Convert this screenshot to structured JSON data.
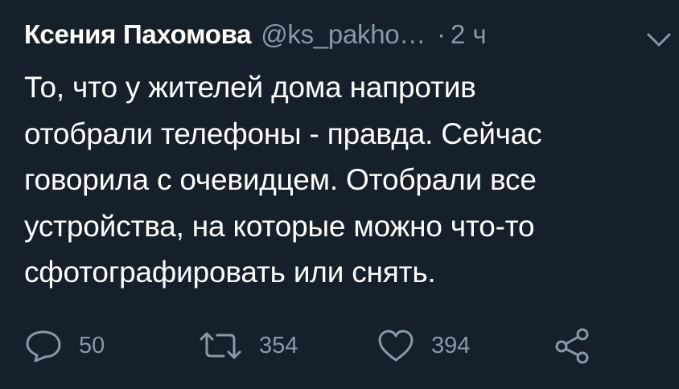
{
  "tweet": {
    "author_name": "Ксения Пахомова",
    "author_handle": "@ks_pakho…",
    "separator": "·",
    "time": "2 ч",
    "text_lines": [
      "То, что у жителей дома напротив",
      "отобрали телефоны - правда. Сейчас",
      "говорила с очевидцем. Отобрали все",
      "устройства, на которые можно что-то",
      "сфотографировать или снять."
    ],
    "actions": {
      "reply_count": "50",
      "retweet_count": "354",
      "like_count": "394"
    }
  },
  "icons": {
    "menu": "chevron-down-icon",
    "reply": "reply-icon",
    "retweet": "retweet-icon",
    "like": "heart-icon",
    "share": "share-icon"
  },
  "colors": {
    "background": "#15202b",
    "primary_text": "#ffffff",
    "secondary_text": "#8899a6"
  }
}
